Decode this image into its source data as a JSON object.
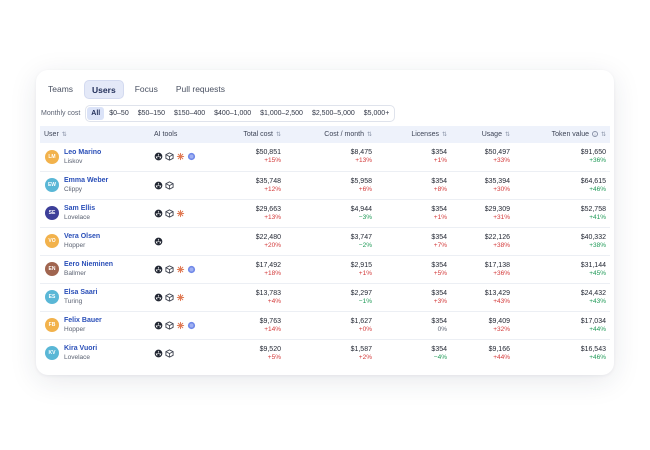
{
  "tabs": [
    "Teams",
    "Users",
    "Focus",
    "Pull requests"
  ],
  "active_tab": "Users",
  "filter": {
    "label": "Monthly cost",
    "chips": [
      "All",
      "$0–50",
      "$50–150",
      "$150–400",
      "$400–1,000",
      "$1,000–2,500",
      "$2,500–5,000",
      "$5,000+"
    ],
    "active": "All"
  },
  "columns": [
    "User",
    "AI tools",
    "Total cost",
    "Cost / month",
    "Licenses",
    "Usage",
    "Token value"
  ],
  "rows": [
    {
      "initials": "LM",
      "color": "#f2b24c",
      "name": "Leo Marino",
      "sub": "Liskov",
      "tools": [
        "openai",
        "cube",
        "sparkle",
        "bubble"
      ],
      "total": "$50,851",
      "total_d": "+15%",
      "month": "$8,475",
      "month_d": "+13%",
      "lic": "$354",
      "lic_d": "+1%",
      "usage": "$50,497",
      "usage_d": "+33%",
      "token": "$91,650",
      "token_d": "+36%"
    },
    {
      "initials": "EW",
      "color": "#5ab7d6",
      "name": "Emma Weber",
      "sub": "Clippy",
      "tools": [
        "openai",
        "cube"
      ],
      "total": "$35,748",
      "total_d": "+12%",
      "month": "$5,958",
      "month_d": "+6%",
      "lic": "$354",
      "lic_d": "+8%",
      "usage": "$35,394",
      "usage_d": "+30%",
      "token": "$64,615",
      "token_d": "+46%"
    },
    {
      "initials": "SE",
      "color": "#3d3f99",
      "name": "Sam Ellis",
      "sub": "Lovelace",
      "tools": [
        "openai",
        "cube",
        "sparkle"
      ],
      "total": "$29,663",
      "total_d": "+13%",
      "month": "$4,944",
      "month_d": "−3%",
      "lic": "$354",
      "lic_d": "+1%",
      "usage": "$29,309",
      "usage_d": "+31%",
      "token": "$52,758",
      "token_d": "+41%"
    },
    {
      "initials": "VO",
      "color": "#f2b24c",
      "name": "Vera Olsen",
      "sub": "Hopper",
      "tools": [
        "openai"
      ],
      "total": "$22,480",
      "total_d": "+20%",
      "month": "$3,747",
      "month_d": "−2%",
      "lic": "$354",
      "lic_d": "+7%",
      "usage": "$22,126",
      "usage_d": "+38%",
      "token": "$40,332",
      "token_d": "+38%"
    },
    {
      "initials": "EN",
      "color": "#a0654f",
      "name": "Eero Nieminen",
      "sub": "Ballmer",
      "tools": [
        "openai",
        "cube",
        "sparkle",
        "bubble"
      ],
      "total": "$17,492",
      "total_d": "+18%",
      "month": "$2,915",
      "month_d": "+1%",
      "lic": "$354",
      "lic_d": "+5%",
      "usage": "$17,138",
      "usage_d": "+36%",
      "token": "$31,144",
      "token_d": "+45%"
    },
    {
      "initials": "ES",
      "color": "#5ab7d6",
      "name": "Elsa Saari",
      "sub": "Turing",
      "tools": [
        "openai",
        "cube",
        "sparkle"
      ],
      "total": "$13,783",
      "total_d": "+4%",
      "month": "$2,297",
      "month_d": "−1%",
      "lic": "$354",
      "lic_d": "+3%",
      "usage": "$13,429",
      "usage_d": "+43%",
      "token": "$24,432",
      "token_d": "+43%"
    },
    {
      "initials": "FB",
      "color": "#f2b24c",
      "name": "Felix Bauer",
      "sub": "Hopper",
      "tools": [
        "openai",
        "cube",
        "sparkle",
        "bubble"
      ],
      "total": "$9,763",
      "total_d": "+14%",
      "month": "$1,627",
      "month_d": "+0%",
      "lic": "$354",
      "lic_d": "0%",
      "usage": "$9,409",
      "usage_d": "+32%",
      "token": "$17,034",
      "token_d": "+44%"
    },
    {
      "initials": "KV",
      "color": "#5ab7d6",
      "name": "Kira Vuori",
      "sub": "Lovelace",
      "tools": [
        "openai",
        "cube"
      ],
      "total": "$9,520",
      "total_d": "+5%",
      "month": "$1,587",
      "month_d": "+2%",
      "lic": "$354",
      "lic_d": "−4%",
      "usage": "$9,166",
      "usage_d": "+44%",
      "token": "$16,543",
      "token_d": "+46%"
    }
  ],
  "colors": {
    "accent": "#2a4fb8",
    "increase": "#d33a3a",
    "decrease": "#1f9a57",
    "header_bg": "#eef2fb"
  }
}
